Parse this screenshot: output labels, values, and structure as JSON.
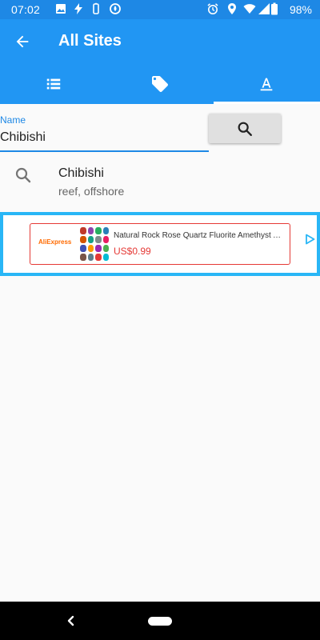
{
  "status_bar": {
    "time": "07:02",
    "battery": "98%",
    "icons": [
      "image-icon",
      "flash-icon",
      "battery-saver-icon",
      "data-saver-icon",
      "alarm-icon",
      "location-icon",
      "wifi-icon",
      "signal-icon",
      "battery-icon"
    ]
  },
  "app_bar": {
    "title": "All Sites",
    "back_icon": "arrow-back-icon"
  },
  "tabs": [
    {
      "icon": "list-icon",
      "active": false
    },
    {
      "icon": "tag-icon",
      "active": false
    },
    {
      "icon": "text-format-icon",
      "active": true
    }
  ],
  "search": {
    "label": "Name",
    "value": "Chibishi",
    "button_icon": "search-icon"
  },
  "results": [
    {
      "title": "Chibishi",
      "subtitle": "reef, offshore"
    }
  ],
  "ad": {
    "brand": "AliExpress",
    "headline": "Natural Rock Rose Quartz Fluorite Amethyst Ap...",
    "price": "US$0.99"
  },
  "colors": {
    "primary": "#2196f3",
    "status_bar": "#1e88e5",
    "accent": "#1e88e5",
    "ad_border": "#29b6f6",
    "price": "#e53935"
  }
}
